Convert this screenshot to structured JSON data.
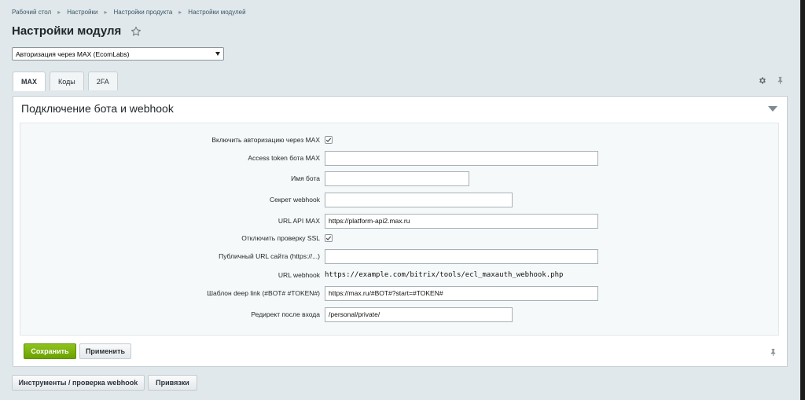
{
  "breadcrumb": [
    "Рабочий стол",
    "Настройки",
    "Настройки продукта",
    "Настройки модулей"
  ],
  "page_title": "Настройки модуля",
  "module_select": {
    "value": "Авторизация через MAX (EcomLabs)"
  },
  "tabs": [
    {
      "label": "MAX",
      "active": true
    },
    {
      "label": "Коды",
      "active": false
    },
    {
      "label": "2FA",
      "active": false
    }
  ],
  "section": {
    "title": "Подключение бота и webhook"
  },
  "form": {
    "enable_auth": {
      "label": "Включить авторизацию через MAX",
      "checked": true
    },
    "access_token": {
      "label": "Access token бота MAX",
      "value": ""
    },
    "bot_name": {
      "label": "Имя бота",
      "value": ""
    },
    "webhook_secret": {
      "label": "Секрет webhook",
      "value": ""
    },
    "api_url": {
      "label": "URL API MAX",
      "value": "https://platform-api2.max.ru"
    },
    "disable_ssl": {
      "label": "Отключить проверку SSL",
      "checked": true
    },
    "public_url": {
      "label": "Публичный URL сайта (https://...)",
      "value": ""
    },
    "webhook_url": {
      "label": "URL webhook",
      "value": "https://example.com/bitrix/tools/ecl_maxauth_webhook.php"
    },
    "deeplink": {
      "label": "Шаблон deep link (#BOT# #TOKEN#)",
      "value": "https://max.ru/#BOT#?start=#TOKEN#"
    },
    "redirect": {
      "label": "Редирект после входа",
      "value": "/personal/private/"
    }
  },
  "buttons": {
    "save": "Сохранить",
    "apply": "Применить",
    "tools": "Инструменты / проверка webhook",
    "bindings": "Привязки"
  },
  "colors": {
    "accent_green": "#7ab317",
    "background": "#e0e8eb"
  }
}
